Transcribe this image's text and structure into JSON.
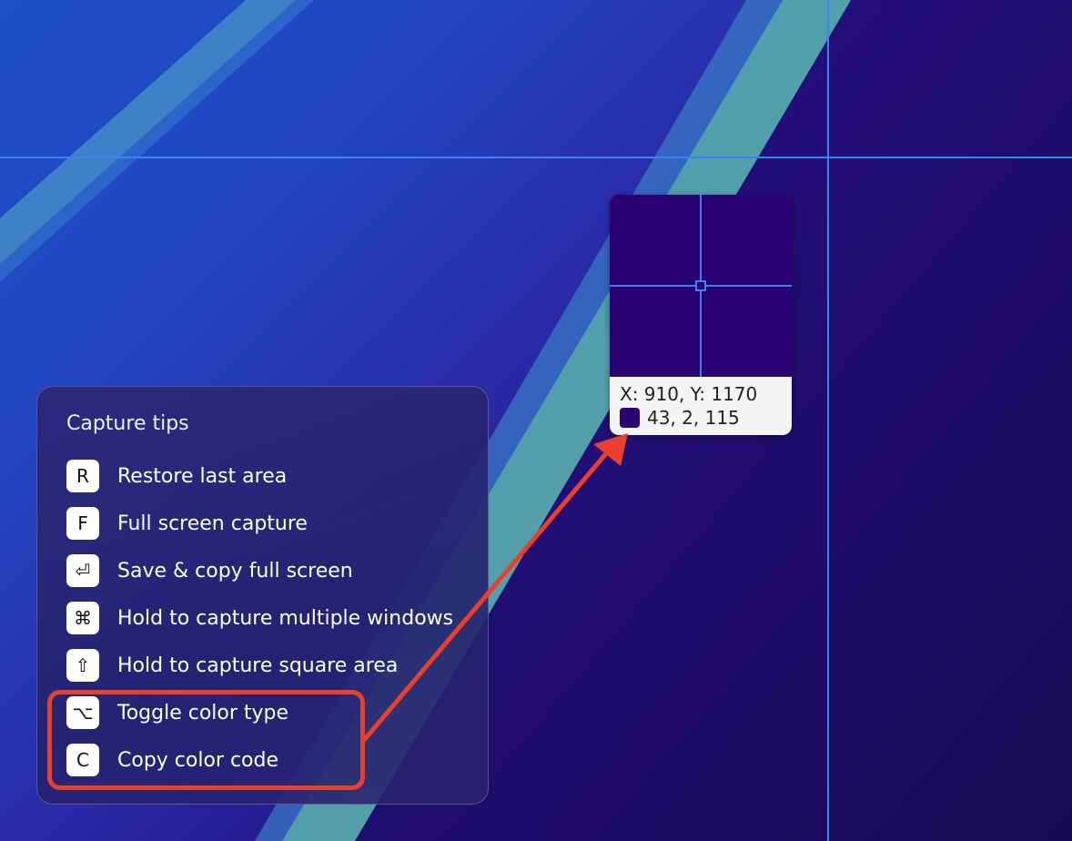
{
  "magnifier": {
    "coords": "X: 910, Y: 1170",
    "rgb": "43, 2, 115",
    "swatch_color": "#2b0273"
  },
  "tips": {
    "title": "Capture tips",
    "items": [
      {
        "key": "R",
        "label": "Restore last area",
        "icon": "r-key"
      },
      {
        "key": "F",
        "label": "Full screen capture",
        "icon": "f-key"
      },
      {
        "key": "⏎",
        "label": "Save & copy full screen",
        "icon": "return-key-icon"
      },
      {
        "key": "⌘",
        "label": "Hold to capture multiple windows",
        "icon": "command-key-icon"
      },
      {
        "key": "⇧",
        "label": "Hold to capture square area",
        "icon": "shift-key-icon"
      },
      {
        "key": "⌥",
        "label": "Toggle color type",
        "icon": "option-key-icon"
      },
      {
        "key": "C",
        "label": "Copy color code",
        "icon": "c-key"
      }
    ]
  },
  "colors": {
    "guide": "#3b82f6",
    "annotation": "#e8402b"
  }
}
